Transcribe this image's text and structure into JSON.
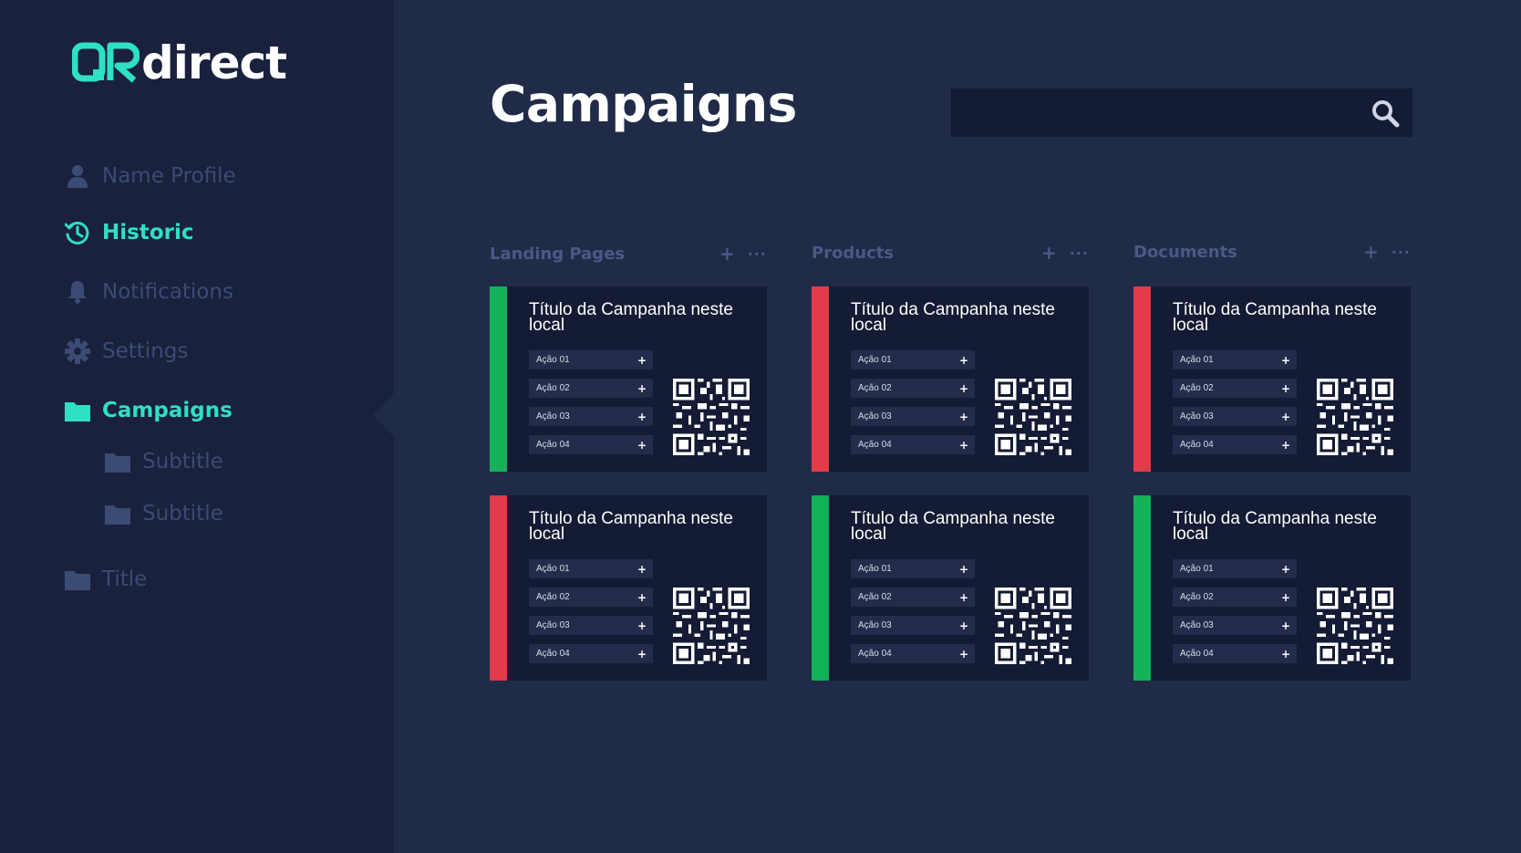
{
  "brand": {
    "logo_text": "direct",
    "logo_mark_text": "QR",
    "accent": "#2ee0c4"
  },
  "sidebar": {
    "items": [
      {
        "label": "Name Profile",
        "icon": "user-icon",
        "active": false
      },
      {
        "label": "Historic",
        "icon": "history-icon",
        "active": true
      },
      {
        "label": "Notifications",
        "icon": "bell-icon",
        "active": false
      },
      {
        "label": "Settings",
        "icon": "gear-icon",
        "active": false
      },
      {
        "label": "Campaigns",
        "icon": "folder-icon",
        "active": true
      },
      {
        "label": "Subtitle",
        "icon": "folder-icon",
        "active": false
      },
      {
        "label": "Subtitle",
        "icon": "folder-icon",
        "active": false
      },
      {
        "label": "Title",
        "icon": "folder-icon",
        "active": false
      }
    ]
  },
  "header": {
    "title": "Campaigns",
    "search_placeholder": "",
    "search_icon": "search-icon"
  },
  "columns": [
    {
      "title": "Landing Pages",
      "add_label": "+",
      "more_label": "···",
      "cards": [
        {
          "title": "Título da Campanha neste local",
          "status_color": "#12b15a",
          "actions": [
            "Ação 01",
            "Ação 02",
            "Ação 03",
            "Ação 04"
          ]
        },
        {
          "title": "Título da Campanha neste local",
          "status_color": "#e23b4a",
          "actions": [
            "Ação 01",
            "Ação 02",
            "Ação 03",
            "Ação 04"
          ]
        }
      ]
    },
    {
      "title": "Products",
      "add_label": "+",
      "more_label": "···",
      "cards": [
        {
          "title": "Título da Campanha neste local",
          "status_color": "#e23b4a",
          "actions": [
            "Ação 01",
            "Ação 02",
            "Ação 03",
            "Ação 04"
          ]
        },
        {
          "title": "Título da Campanha neste local",
          "status_color": "#12b15a",
          "actions": [
            "Ação 01",
            "Ação 02",
            "Ação 03",
            "Ação 04"
          ]
        }
      ]
    },
    {
      "title": "Documents",
      "add_label": "+",
      "more_label": "···",
      "cards": [
        {
          "title": "Título da Campanha neste local",
          "status_color": "#e23b4a",
          "actions": [
            "Ação 01",
            "Ação 02",
            "Ação 03",
            "Ação 04"
          ]
        },
        {
          "title": "Título da Campanha neste local",
          "status_color": "#12b15a",
          "actions": [
            "Ação 01",
            "Ação 02",
            "Ação 03",
            "Ação 04"
          ]
        }
      ]
    }
  ],
  "action_add_label": "+"
}
